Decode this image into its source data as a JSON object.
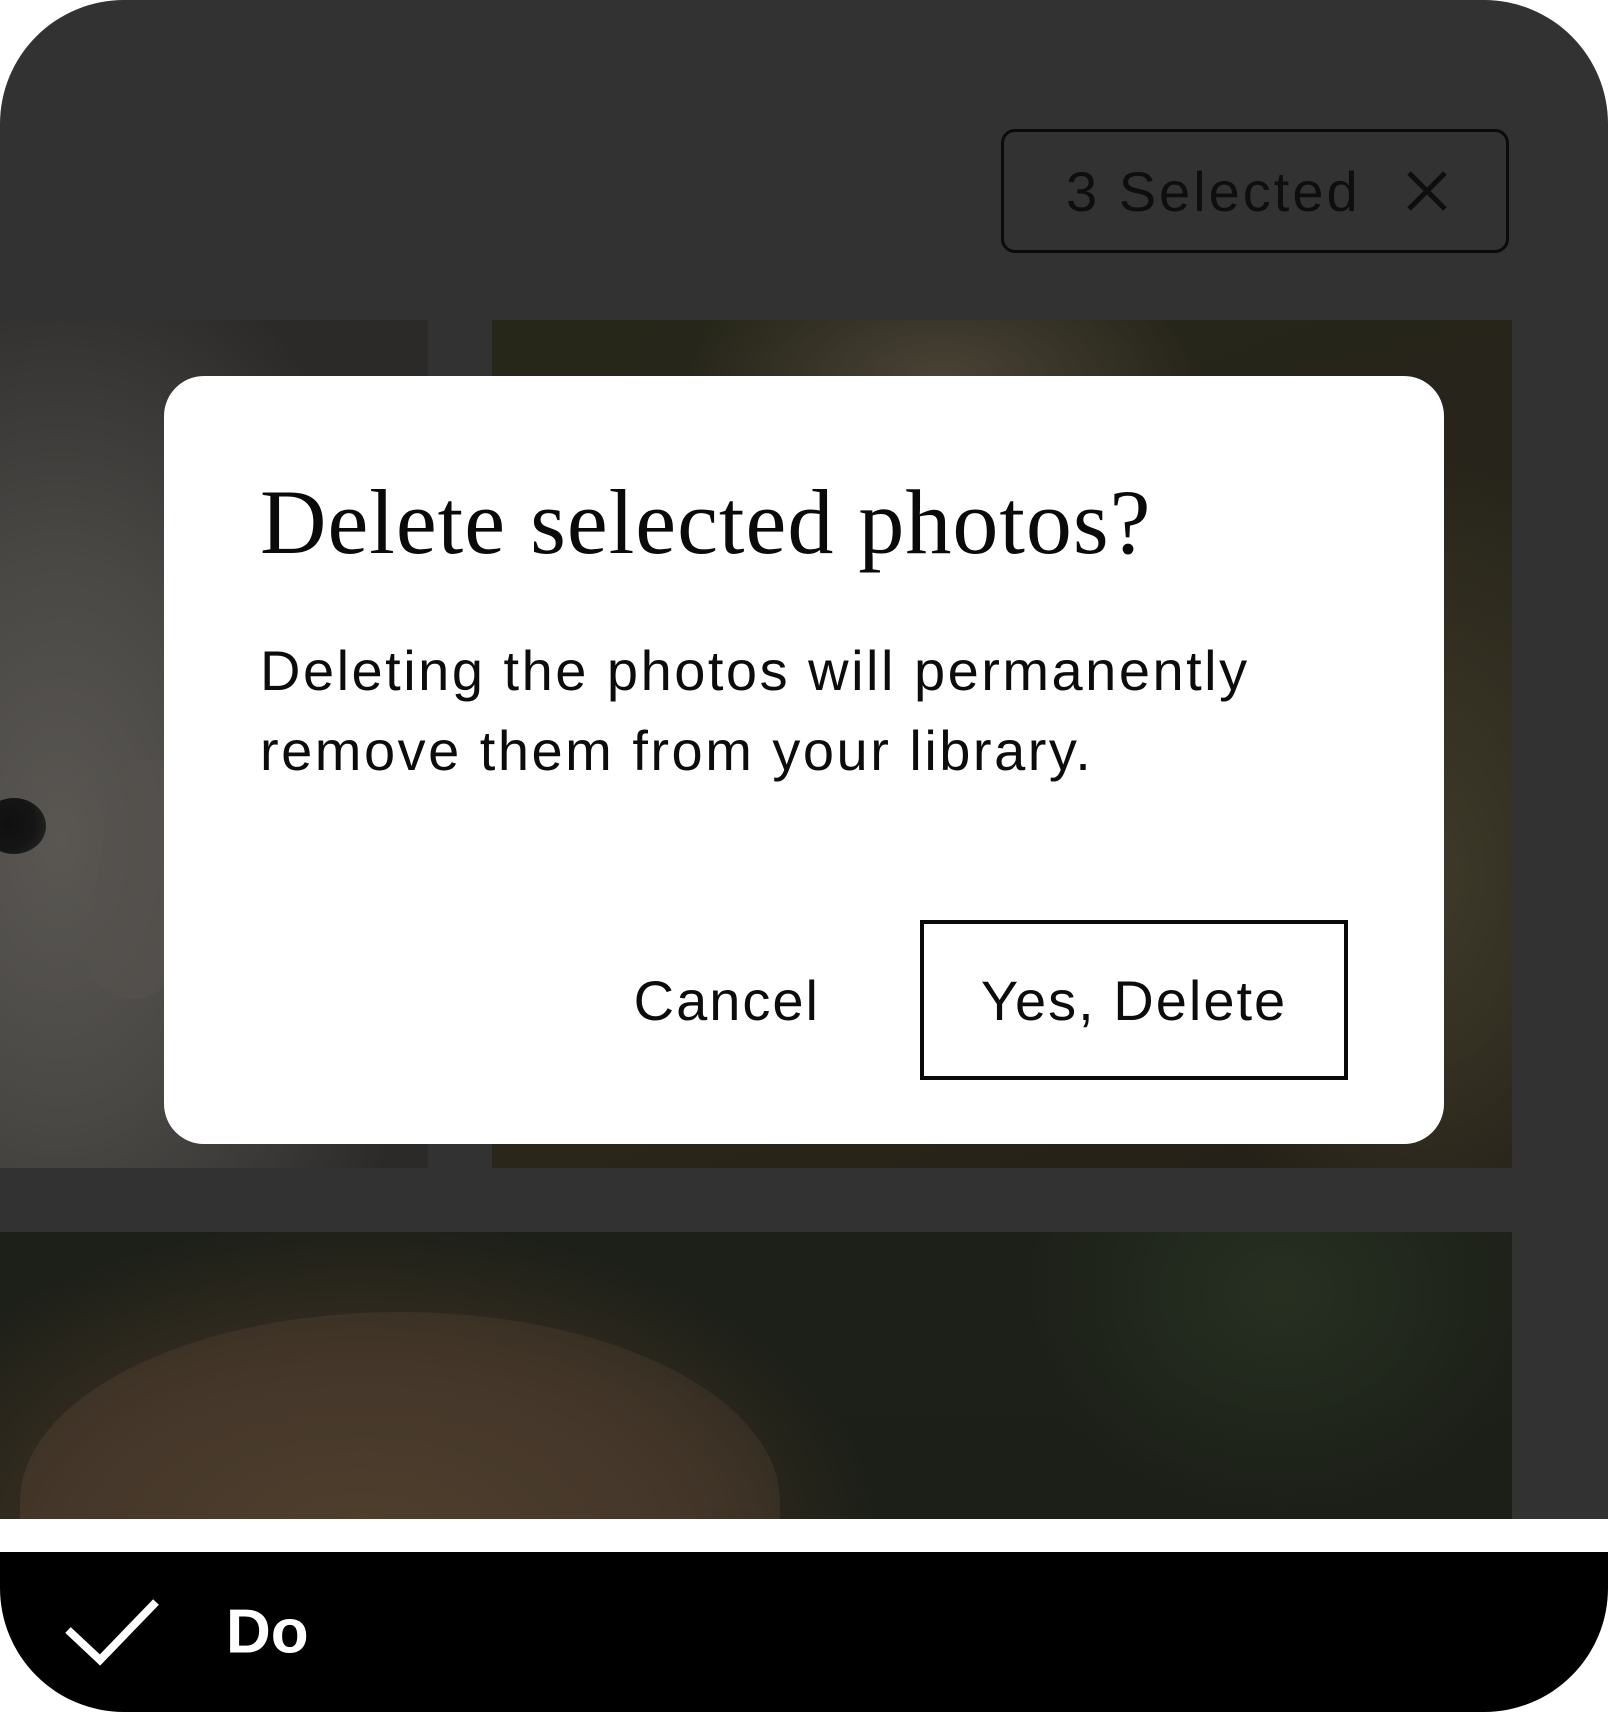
{
  "selection": {
    "label": "3 Selected",
    "close_icon": "close-icon"
  },
  "dialog": {
    "title": "Delete selected photos?",
    "body": "Deleting the photos will permanently remove them from your library.",
    "cancel_label": "Cancel",
    "confirm_label": "Yes, Delete"
  },
  "caption": {
    "label": "Do",
    "icon": "checkmark-icon"
  },
  "colors": {
    "scrim": "#323232",
    "dialog_background": "#ffffff",
    "caption_background": "#000000",
    "caption_text": "#ffffff"
  }
}
